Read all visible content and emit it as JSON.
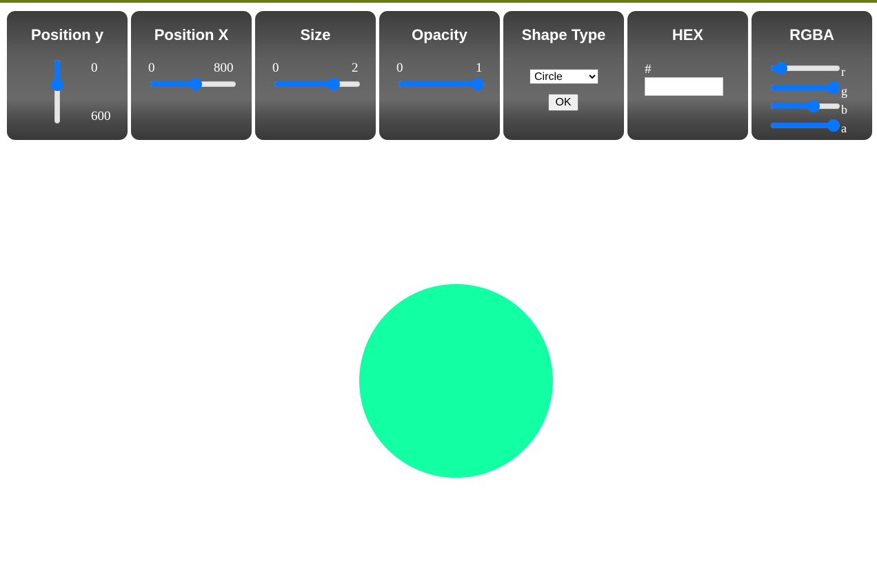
{
  "controls": {
    "position_y": {
      "title": "Position y",
      "min_label": "0",
      "max_label": "600",
      "min": 0,
      "max": 600,
      "value": 219
    },
    "position_x": {
      "title": "Position X",
      "min_label": "0",
      "max_label": "800",
      "min": 0,
      "max": 800,
      "value": 431
    },
    "size": {
      "title": "Size",
      "min_label": "0",
      "max_label": "2",
      "min": 0,
      "max": 2,
      "value": 1.45
    },
    "opacity": {
      "title": "Opacity",
      "min_label": "0",
      "max_label": "1",
      "min": 0,
      "max": 1,
      "value": 1
    },
    "shape_type": {
      "title": "Shape Type",
      "selected": "Circle",
      "options": [
        "Circle"
      ],
      "ok_label": "OK"
    },
    "hex": {
      "title": "HEX",
      "prefix": "#",
      "value": ""
    },
    "rgba": {
      "title": "RGBA",
      "channels": [
        {
          "label": "r",
          "value": 18,
          "max": 255
        },
        {
          "label": "g",
          "value": 255,
          "max": 255
        },
        {
          "label": "b",
          "value": 164,
          "max": 255
        },
        {
          "label": "a",
          "value": 1,
          "max": 1
        }
      ]
    }
  },
  "canvas": {
    "shape": "circle",
    "fill_color": "#12ffa4"
  },
  "colors": {
    "slider_accent": "#0a75ff",
    "top_strip": "#6b7a14",
    "panel_dark": "#3c3c3c",
    "panel_light": "#6a6a6a"
  }
}
